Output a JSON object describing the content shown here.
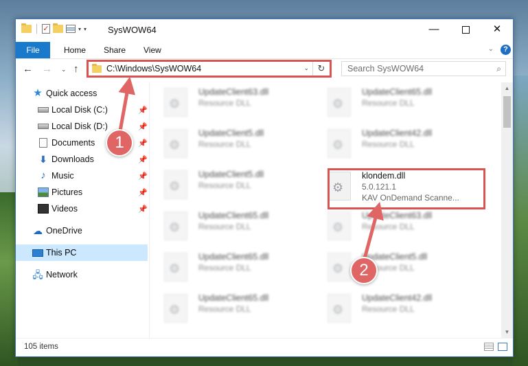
{
  "window": {
    "title": "SysWOW64",
    "minimize_glyph": "—",
    "close_glyph": "✕"
  },
  "ribbon": {
    "file_tab": "File",
    "tabs": [
      "Home",
      "Share",
      "View"
    ],
    "chevron_glyph": "⌄",
    "help_glyph": "?"
  },
  "nav": {
    "back_glyph": "←",
    "forward_glyph": "→",
    "recent_glyph": "⌄",
    "up_glyph": "↑",
    "address_path": "C:\\Windows\\SysWOW64",
    "address_dropdown_glyph": "⌄",
    "refresh_glyph": "↻",
    "search_placeholder": "Search SysWOW64",
    "search_glyph": "⌕"
  },
  "sidebar": {
    "pin_glyph": "📌",
    "items": [
      {
        "label": "Quick access",
        "icon": "star-icon"
      },
      {
        "label": "Local Disk (C:)",
        "icon": "disk-icon",
        "pinned": true
      },
      {
        "label": "Local Disk (D:)",
        "icon": "disk-icon",
        "pinned": true
      },
      {
        "label": "Documents",
        "icon": "documents-icon",
        "pinned": true
      },
      {
        "label": "Downloads",
        "icon": "downloads-icon",
        "pinned": true
      },
      {
        "label": "Music",
        "icon": "music-icon",
        "pinned": true
      },
      {
        "label": "Pictures",
        "icon": "pictures-icon",
        "pinned": true
      },
      {
        "label": "Videos",
        "icon": "videos-icon",
        "pinned": true
      },
      {
        "label": "OneDrive",
        "icon": "onedrive-icon"
      },
      {
        "label": "This PC",
        "icon": "this-pc-icon",
        "selected": true
      },
      {
        "label": "Network",
        "icon": "network-icon"
      }
    ]
  },
  "files": {
    "gear_glyph": "⚙",
    "left_column": [
      {
        "name": "UpdateClient63.dll",
        "type": "Resource DLL"
      },
      {
        "name": "UpdateClient5.dll",
        "type": "Resource DLL"
      },
      {
        "name": "UpdateClient5.dll",
        "type": "Resource DLL"
      },
      {
        "name": "UpdateClient65.dll",
        "type": "Resource DLL"
      },
      {
        "name": "UpdateClient65.dll",
        "type": "Resource DLL"
      },
      {
        "name": "UpdateClient65.dll",
        "type": "Resource DLL"
      }
    ],
    "right_column": [
      {
        "name": "UpdateClient65.dll",
        "type": "Resource DLL"
      },
      {
        "name": "UpdateClient42.dll",
        "type": "Resource DLL"
      },
      {
        "name": "klondem.dll",
        "version": "5.0.121.1",
        "description": "KAV OnDemand Scanne..."
      },
      {
        "name": "UpdateClient63.dll",
        "type": "Resource DLL"
      },
      {
        "name": "UpdateClient5.dll",
        "type": "Resource DLL"
      },
      {
        "name": "UpdateClient42.dll",
        "type": "Resource DLL"
      }
    ]
  },
  "scroll_glyphs": {
    "up": "▲",
    "down": "▼"
  },
  "status": {
    "item_count": "105 items"
  },
  "annotations": {
    "step1": "1",
    "step2": "2",
    "color": "#e06666"
  }
}
